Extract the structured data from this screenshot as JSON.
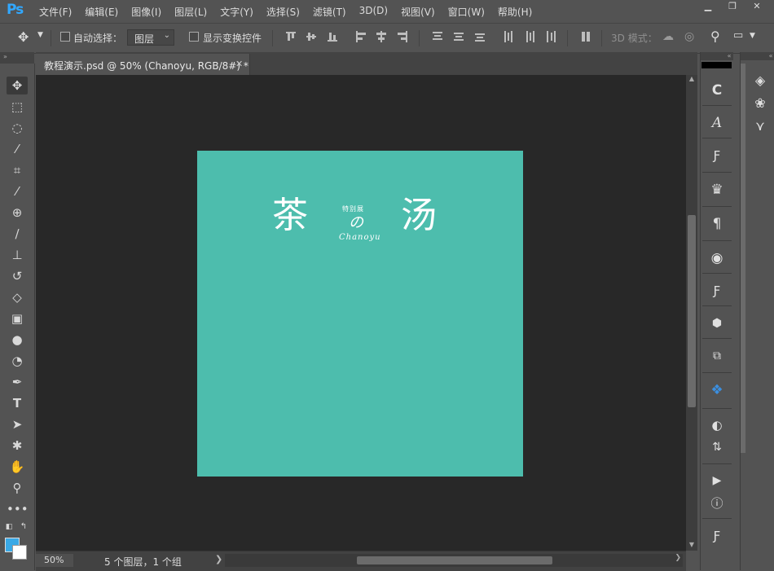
{
  "app": {
    "logo": "Ps"
  },
  "menu": [
    "文件(F)",
    "编辑(E)",
    "图像(I)",
    "图层(L)",
    "文字(Y)",
    "选择(S)",
    "滤镜(T)",
    "3D(D)",
    "视图(V)",
    "窗口(W)",
    "帮助(H)"
  ],
  "window_controls": {
    "minimize": "▁",
    "restore": "❐",
    "close": "✕"
  },
  "options": {
    "auto_select_label": "自动选择：",
    "auto_select_checked": false,
    "target_value": "图层",
    "show_transform_label": "显示变换控件",
    "show_transform_checked": false,
    "mode_3d_label": "3D 模式："
  },
  "document_tab": {
    "title": "教程演示.psd @ 50% (Chanoyu, RGB/8#) *",
    "close": "✕"
  },
  "artwork": {
    "char_left": "茶",
    "char_right": "汤",
    "special": "特别展",
    "no": "の",
    "romaji": "Chanoyu",
    "bg_color": "#4dbdad"
  },
  "status": {
    "zoom": "50%",
    "layers": "5 个图层，1 个组",
    "arrow": "❯"
  },
  "tools": [
    "move-tool",
    "marquee-tool",
    "lasso-tool",
    "magic-wand-tool",
    "crop-tool",
    "eyedropper-tool",
    "healing-brush-tool",
    "brush-tool",
    "stamp-tool",
    "history-brush-tool",
    "eraser-tool",
    "gradient-tool",
    "blur-tool",
    "dodge-tool",
    "pen-tool",
    "type-tool",
    "path-selection-tool",
    "shape-tool",
    "hand-tool",
    "zoom-tool",
    "more-tools"
  ],
  "colors": {
    "foreground": "#3aa9e6",
    "background": "#ffffff"
  },
  "panels_col1": [
    "history",
    "character",
    "glyph-style",
    "crown-plugin",
    "paragraph",
    "adjust-plugin",
    "glyph-style-2",
    "cube-plugin",
    "transform-plugin",
    "bird-plugin",
    "mask",
    "flip",
    "play-actions",
    "info",
    "glyph-style-3"
  ],
  "panels_col2": [
    "layers",
    "channels",
    "paths"
  ]
}
